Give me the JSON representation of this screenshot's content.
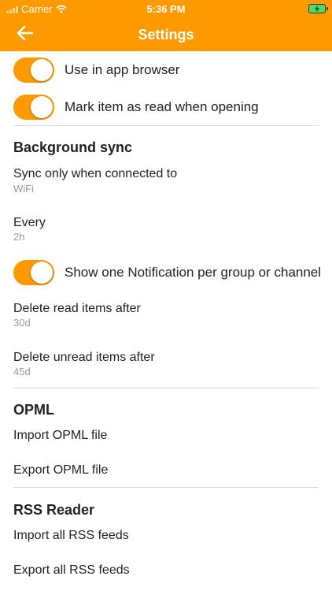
{
  "status": {
    "carrier": "Carrier",
    "time": "5:36 PM"
  },
  "header": {
    "title": "Settings"
  },
  "icons": {
    "back": "arrow-left-icon",
    "wifi": "wifi-icon",
    "battery": "battery-charging-icon",
    "signal": "signal-bars-icon"
  },
  "colors": {
    "accent": "#ff9900"
  },
  "toggles": [
    {
      "label": "Use in app browser",
      "on": true
    },
    {
      "label": "Mark item as read when opening",
      "on": true
    }
  ],
  "background_sync": {
    "title": "Background sync",
    "sync_when": {
      "label": "Sync only when connected to",
      "value": "WiFi"
    },
    "every": {
      "label": "Every",
      "value": "2h"
    },
    "notification_toggle": {
      "label": "Show one Notification per group or channel",
      "on": true
    },
    "delete_read": {
      "label": "Delete read items after",
      "value": "30d"
    },
    "delete_unread": {
      "label": "Delete unread items after",
      "value": "45d"
    }
  },
  "opml": {
    "title": "OPML",
    "import_label": "Import OPML file",
    "export_label": "Export OPML file"
  },
  "rss_reader": {
    "title": "RSS Reader",
    "import_label": "Import all RSS feeds",
    "export_label": "Export all RSS feeds"
  }
}
